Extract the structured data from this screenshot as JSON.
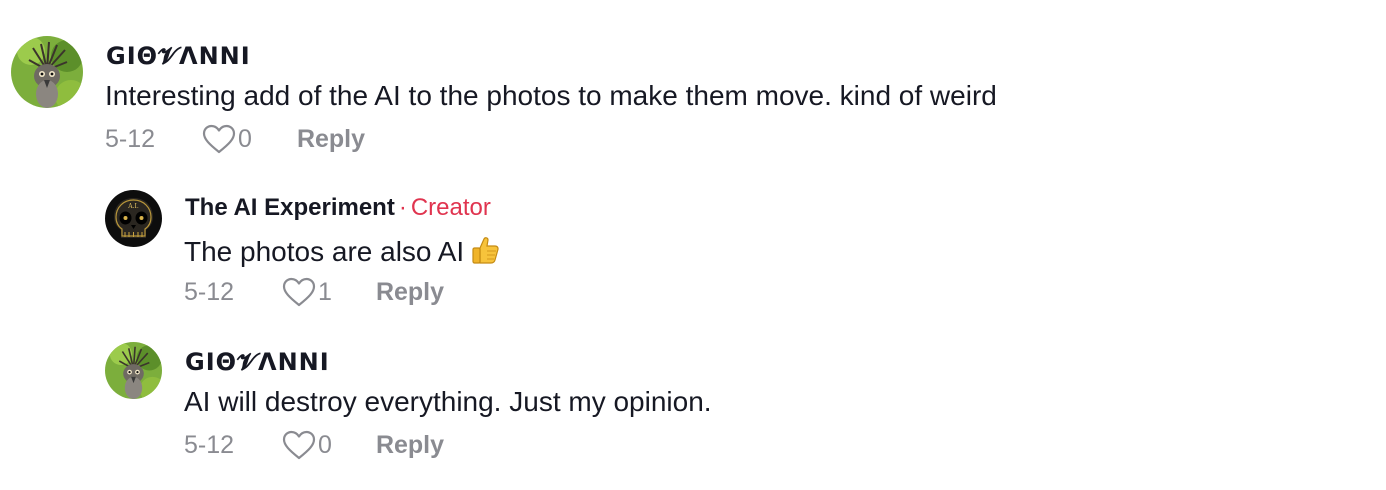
{
  "comments": [
    {
      "username": "GIΘ𝓥ΛΝΝΙ",
      "text": "Interesting add of the AI to the photos to make them move. kind of weird",
      "date": "5-12",
      "likes": "0",
      "reply_label": "Reply"
    },
    {
      "username": "The AI Experiment",
      "creator_separator": "·",
      "creator_label": "Creator",
      "text": "The photos are also AI",
      "emoji_icon": "thumbs-up-icon",
      "date": "5-12",
      "likes": "1",
      "reply_label": "Reply"
    },
    {
      "username": "GIΘ𝓥ΛΝΝΙ",
      "text": "AI will destroy everything. Just my opinion.",
      "date": "5-12",
      "likes": "0",
      "reply_label": "Reply"
    }
  ],
  "colors": {
    "creator": "#e0344f",
    "meta": "#8a8b91",
    "text": "#161823"
  }
}
